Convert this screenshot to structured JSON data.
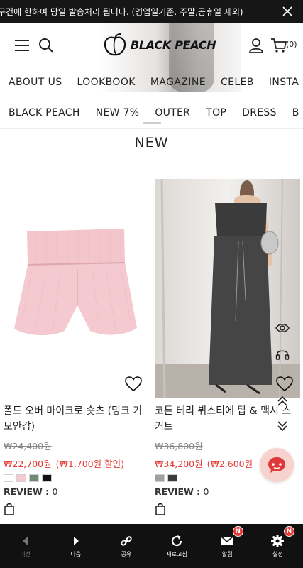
{
  "notice": {
    "text": "구건에 한하여 당일 발송처리 됩니다. (영업일기준. 주말,공휴일 제외)"
  },
  "header": {
    "logo_text": "BLACK PEACH",
    "cart_count": "(0)"
  },
  "main_menu": [
    "ABOUT US",
    "LOOKBOOK",
    "MAGAZINE",
    "CELEB",
    "INSTA"
  ],
  "category_menu": [
    "BLACK PEACH",
    "NEW 7%",
    "OUTER",
    "TOP",
    "DRESS",
    "B"
  ],
  "section_title": "NEW",
  "products": [
    {
      "name": "폴드 오버 마이크로 숏츠 (밍크 기모안감)",
      "original_price": "₩24,400원",
      "sale_price": "₩22,700원",
      "discount": "(₩1,700원 할인)",
      "colors": [
        "#ffffff",
        "#f4c9cf",
        "#6f8a6e",
        "#111111"
      ],
      "review_label": "REVIEW :",
      "review_count": "0"
    },
    {
      "name": "코튼 테리 뷔스티에 탑 & 맥시 스커트",
      "original_price": "₩36,800원",
      "sale_price": "₩34,200원",
      "discount": "(₩2,600원",
      "colors": [
        "#a0a0a0",
        "#3b3b3b"
      ],
      "review_label": "REVIEW :",
      "review_count": "0"
    }
  ],
  "bottom_nav": [
    {
      "label": "이전",
      "icon": "back-icon",
      "disabled": true
    },
    {
      "label": "다음",
      "icon": "forward-icon"
    },
    {
      "label": "공유",
      "icon": "share-icon"
    },
    {
      "label": "새로고침",
      "icon": "refresh-icon"
    },
    {
      "label": "알림",
      "icon": "mail-icon",
      "badge": "N"
    },
    {
      "label": "설정",
      "icon": "gear-icon",
      "badge": "N"
    }
  ],
  "colors": {
    "sale": "#e53935",
    "bar": "#111111",
    "chat_bg": "#f6d3cf",
    "chat_icon": "#e0393a"
  }
}
